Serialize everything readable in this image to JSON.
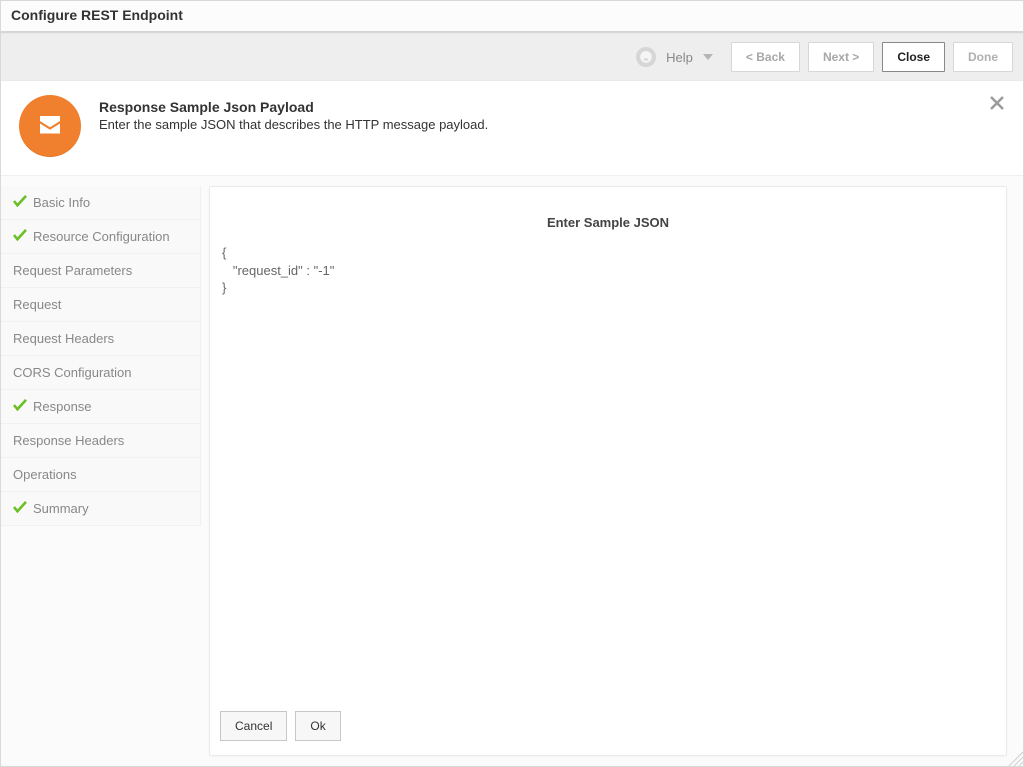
{
  "title": "Configure REST Endpoint",
  "toolbar": {
    "help_label": "Help",
    "back_label": "<  Back",
    "next_label": "Next  >",
    "close_label": "Close",
    "done_label": "Done"
  },
  "header": {
    "title": "Response Sample Json Payload",
    "subtitle": "Enter the sample JSON that describes the HTTP message payload."
  },
  "sidebar": {
    "items": [
      {
        "label": "Basic Info",
        "checked": true
      },
      {
        "label": "Resource Configuration",
        "checked": true
      },
      {
        "label": "Request Parameters",
        "checked": false
      },
      {
        "label": "Request",
        "checked": false
      },
      {
        "label": "Request Headers",
        "checked": false
      },
      {
        "label": "CORS Configuration",
        "checked": false
      },
      {
        "label": "Response",
        "checked": true
      },
      {
        "label": "Response Headers",
        "checked": false
      },
      {
        "label": "Operations",
        "checked": false
      },
      {
        "label": "Summary",
        "checked": true
      }
    ]
  },
  "main": {
    "heading": "Enter Sample JSON",
    "json_value": "{\n   \"request_id\" : \"-1\"\n}",
    "cancel_label": "Cancel",
    "ok_label": "Ok"
  }
}
